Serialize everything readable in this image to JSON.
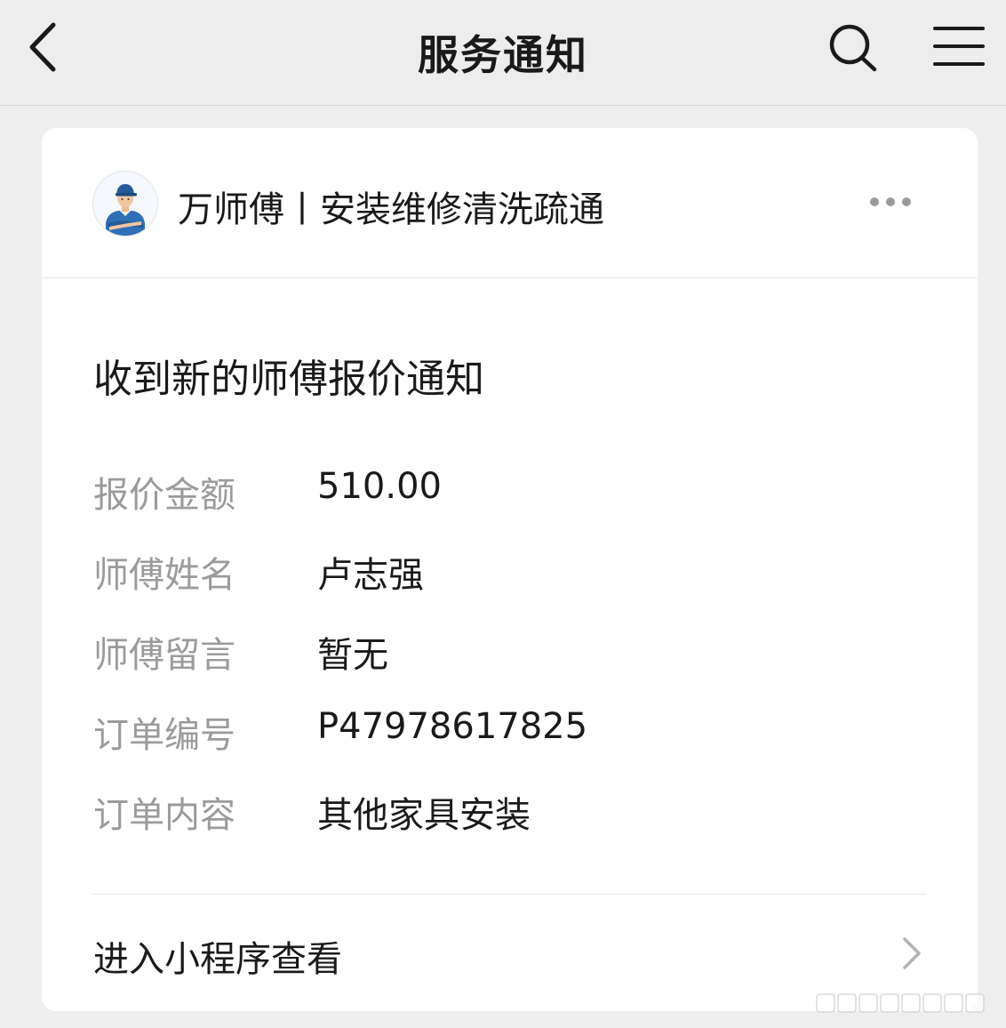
{
  "topbar": {
    "title": "服务通知",
    "back_icon": "chevron-left-icon",
    "search_icon": "search-icon",
    "menu_icon": "hamburger-menu-icon"
  },
  "card": {
    "header": {
      "service_name": "万师傅丨安装维修清洗疏通",
      "avatar_icon": "technician-avatar",
      "more_icon": "more-dots-icon"
    },
    "notification_title": "收到新的师傅报价通知",
    "fields": [
      {
        "label": "报价金额",
        "value": "510.00"
      },
      {
        "label": "师傅姓名",
        "value": "卢志强"
      },
      {
        "label": "师傅留言",
        "value": "暂无"
      },
      {
        "label": "订单编号",
        "value": "P47978617825"
      },
      {
        "label": "订单内容",
        "value": "其他家具安装"
      }
    ],
    "footer": {
      "link_label": "进入小程序查看",
      "chevron_icon": "chevron-right-icon"
    }
  },
  "colors": {
    "background": "#efefef",
    "card": "#ffffff",
    "label_gray": "#9b9b9b",
    "text": "#1a1a1a",
    "avatar_blue": "#2f6fb5"
  }
}
